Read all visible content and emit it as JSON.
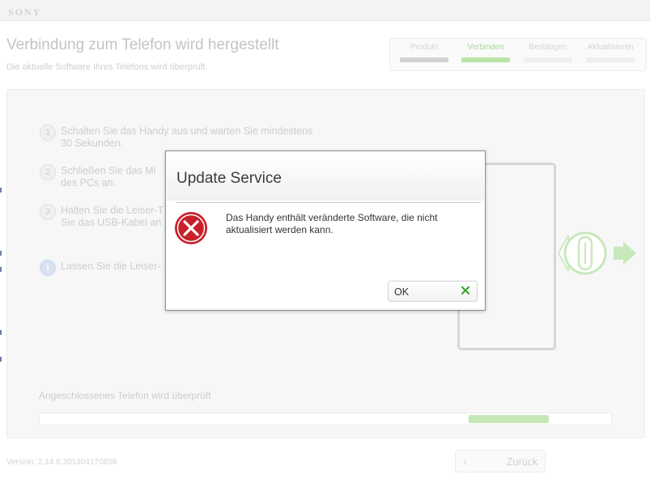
{
  "app": {
    "logo": "SONY",
    "title": "Verbindung zum Telefon wird hergestellt",
    "subtitle": "Die aktuelle Software Ihres Telefons wird überprüft"
  },
  "steps": [
    {
      "label": "Produkt",
      "state": "done"
    },
    {
      "label": "Verbinden",
      "state": "active"
    },
    {
      "label": "Bestätigen",
      "state": "pending"
    },
    {
      "label": "Aktualisieren",
      "state": "pending"
    }
  ],
  "instructions": [
    {
      "num": "1",
      "line1": "Schalten Sie das Handy aus und warten Sie mindestens",
      "line2": "30 Sekunden."
    },
    {
      "num": "2",
      "line1": "Schließen Sie das Mi",
      "line2": "des PCs an."
    },
    {
      "num": "3",
      "line1": "Halten Sie die Leiser-T",
      "line2": "Sie das USB-Kabel an"
    },
    {
      "num": "i",
      "line1": "Lassen Sie die Leiser-"
    }
  ],
  "status": {
    "label": "Angeschlossenes Telefon wird überprüft",
    "progress_fraction": 0.14
  },
  "footer": {
    "version": "Version: 2.14.6.201404170858",
    "back_label": "Zurück"
  },
  "dialog": {
    "title": "Update Service",
    "message": "Das Handy enthält veränderte Software, die nicht aktualisiert werden kann.",
    "ok_label": "OK"
  },
  "colors": {
    "accent_green": "#b7e3a6",
    "error_red": "#c8202b",
    "confirm_green": "#3fa535"
  }
}
